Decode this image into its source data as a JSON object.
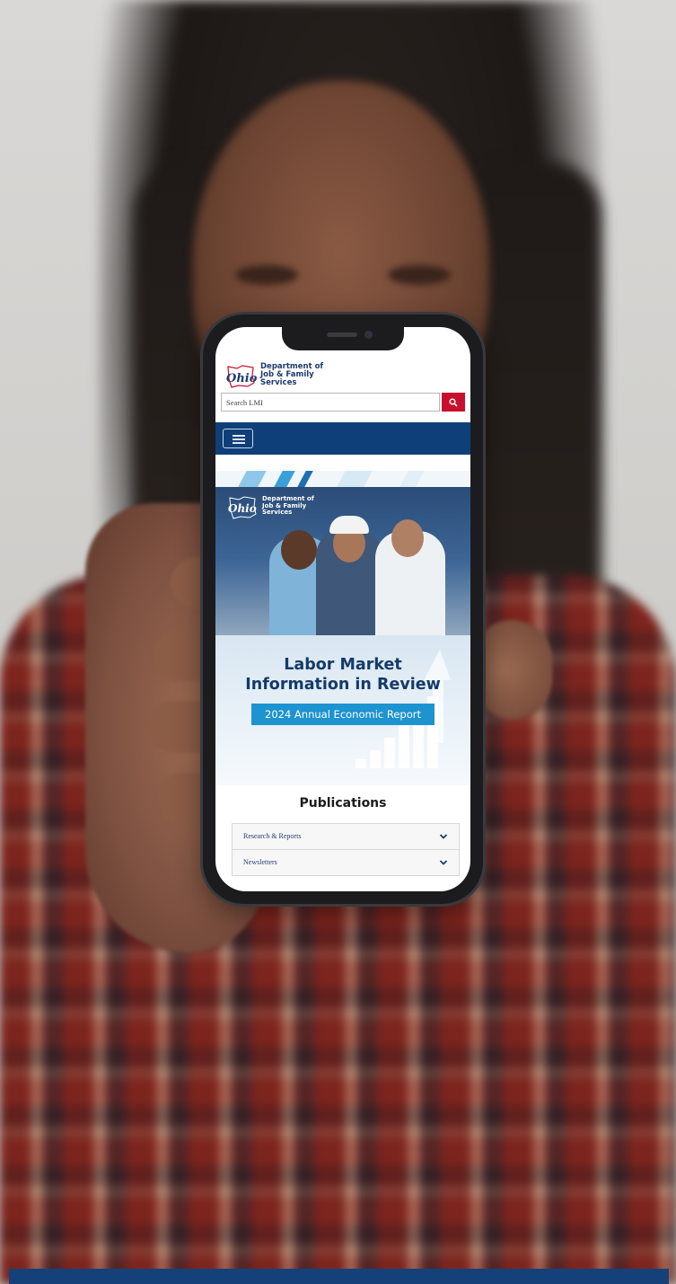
{
  "site": {
    "logo_word": "Ohio",
    "department_name_line1": "Department of",
    "department_name_line2": "Job & Family",
    "department_name_line3": "Services"
  },
  "search": {
    "placeholder": "Search LMI"
  },
  "hero": {
    "title_line1": "Labor Market",
    "title_line2": "Information in Review",
    "badge": "2024 Annual Economic Report",
    "photo_logo_line1": "Department of",
    "photo_logo_line2": "Job & Family",
    "photo_logo_line3": "Services"
  },
  "publications": {
    "heading": "Publications",
    "items": [
      {
        "label": "Research & Reports"
      },
      {
        "label": "Newsletters"
      }
    ]
  },
  "icons": {
    "search": "search-icon",
    "menu": "hamburger-menu-icon",
    "chevron": "chevron-down-icon"
  },
  "colors": {
    "navy": "#0f3f79",
    "brand_red": "#c8102e",
    "accent_blue": "#1d93d0",
    "title_blue": "#153a6a"
  }
}
